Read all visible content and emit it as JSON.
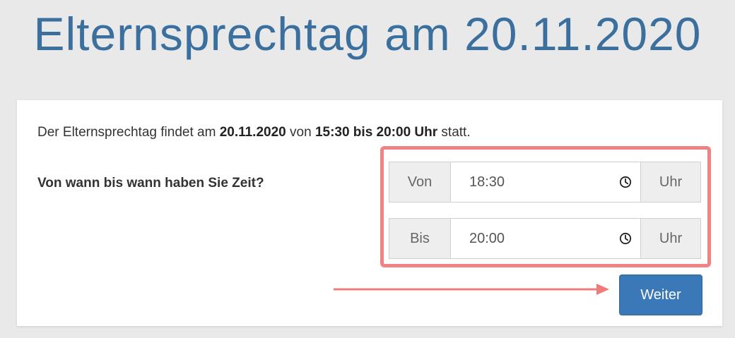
{
  "header": {
    "title": "Elternsprechtag am 20.11.2020"
  },
  "info": {
    "part1": "Der Elternsprechtag findet am ",
    "date": "20.11.2020",
    "part2": " von ",
    "time_range": "15:30 bis 20:00 Uhr",
    "part3": " statt."
  },
  "question": "Von wann bis wann haben Sie Zeit?",
  "time_from": {
    "label": "Von",
    "value": "18:30",
    "unit": "Uhr",
    "icon": "clock-icon"
  },
  "time_to": {
    "label": "Bis",
    "value": "20:00",
    "unit": "Uhr",
    "icon": "clock-icon"
  },
  "next_button": {
    "label": "Weiter"
  },
  "colors": {
    "title": "#3a6f9e",
    "highlight": "#ef8282",
    "button": "#3a78b8",
    "background": "#e9e9e9"
  }
}
